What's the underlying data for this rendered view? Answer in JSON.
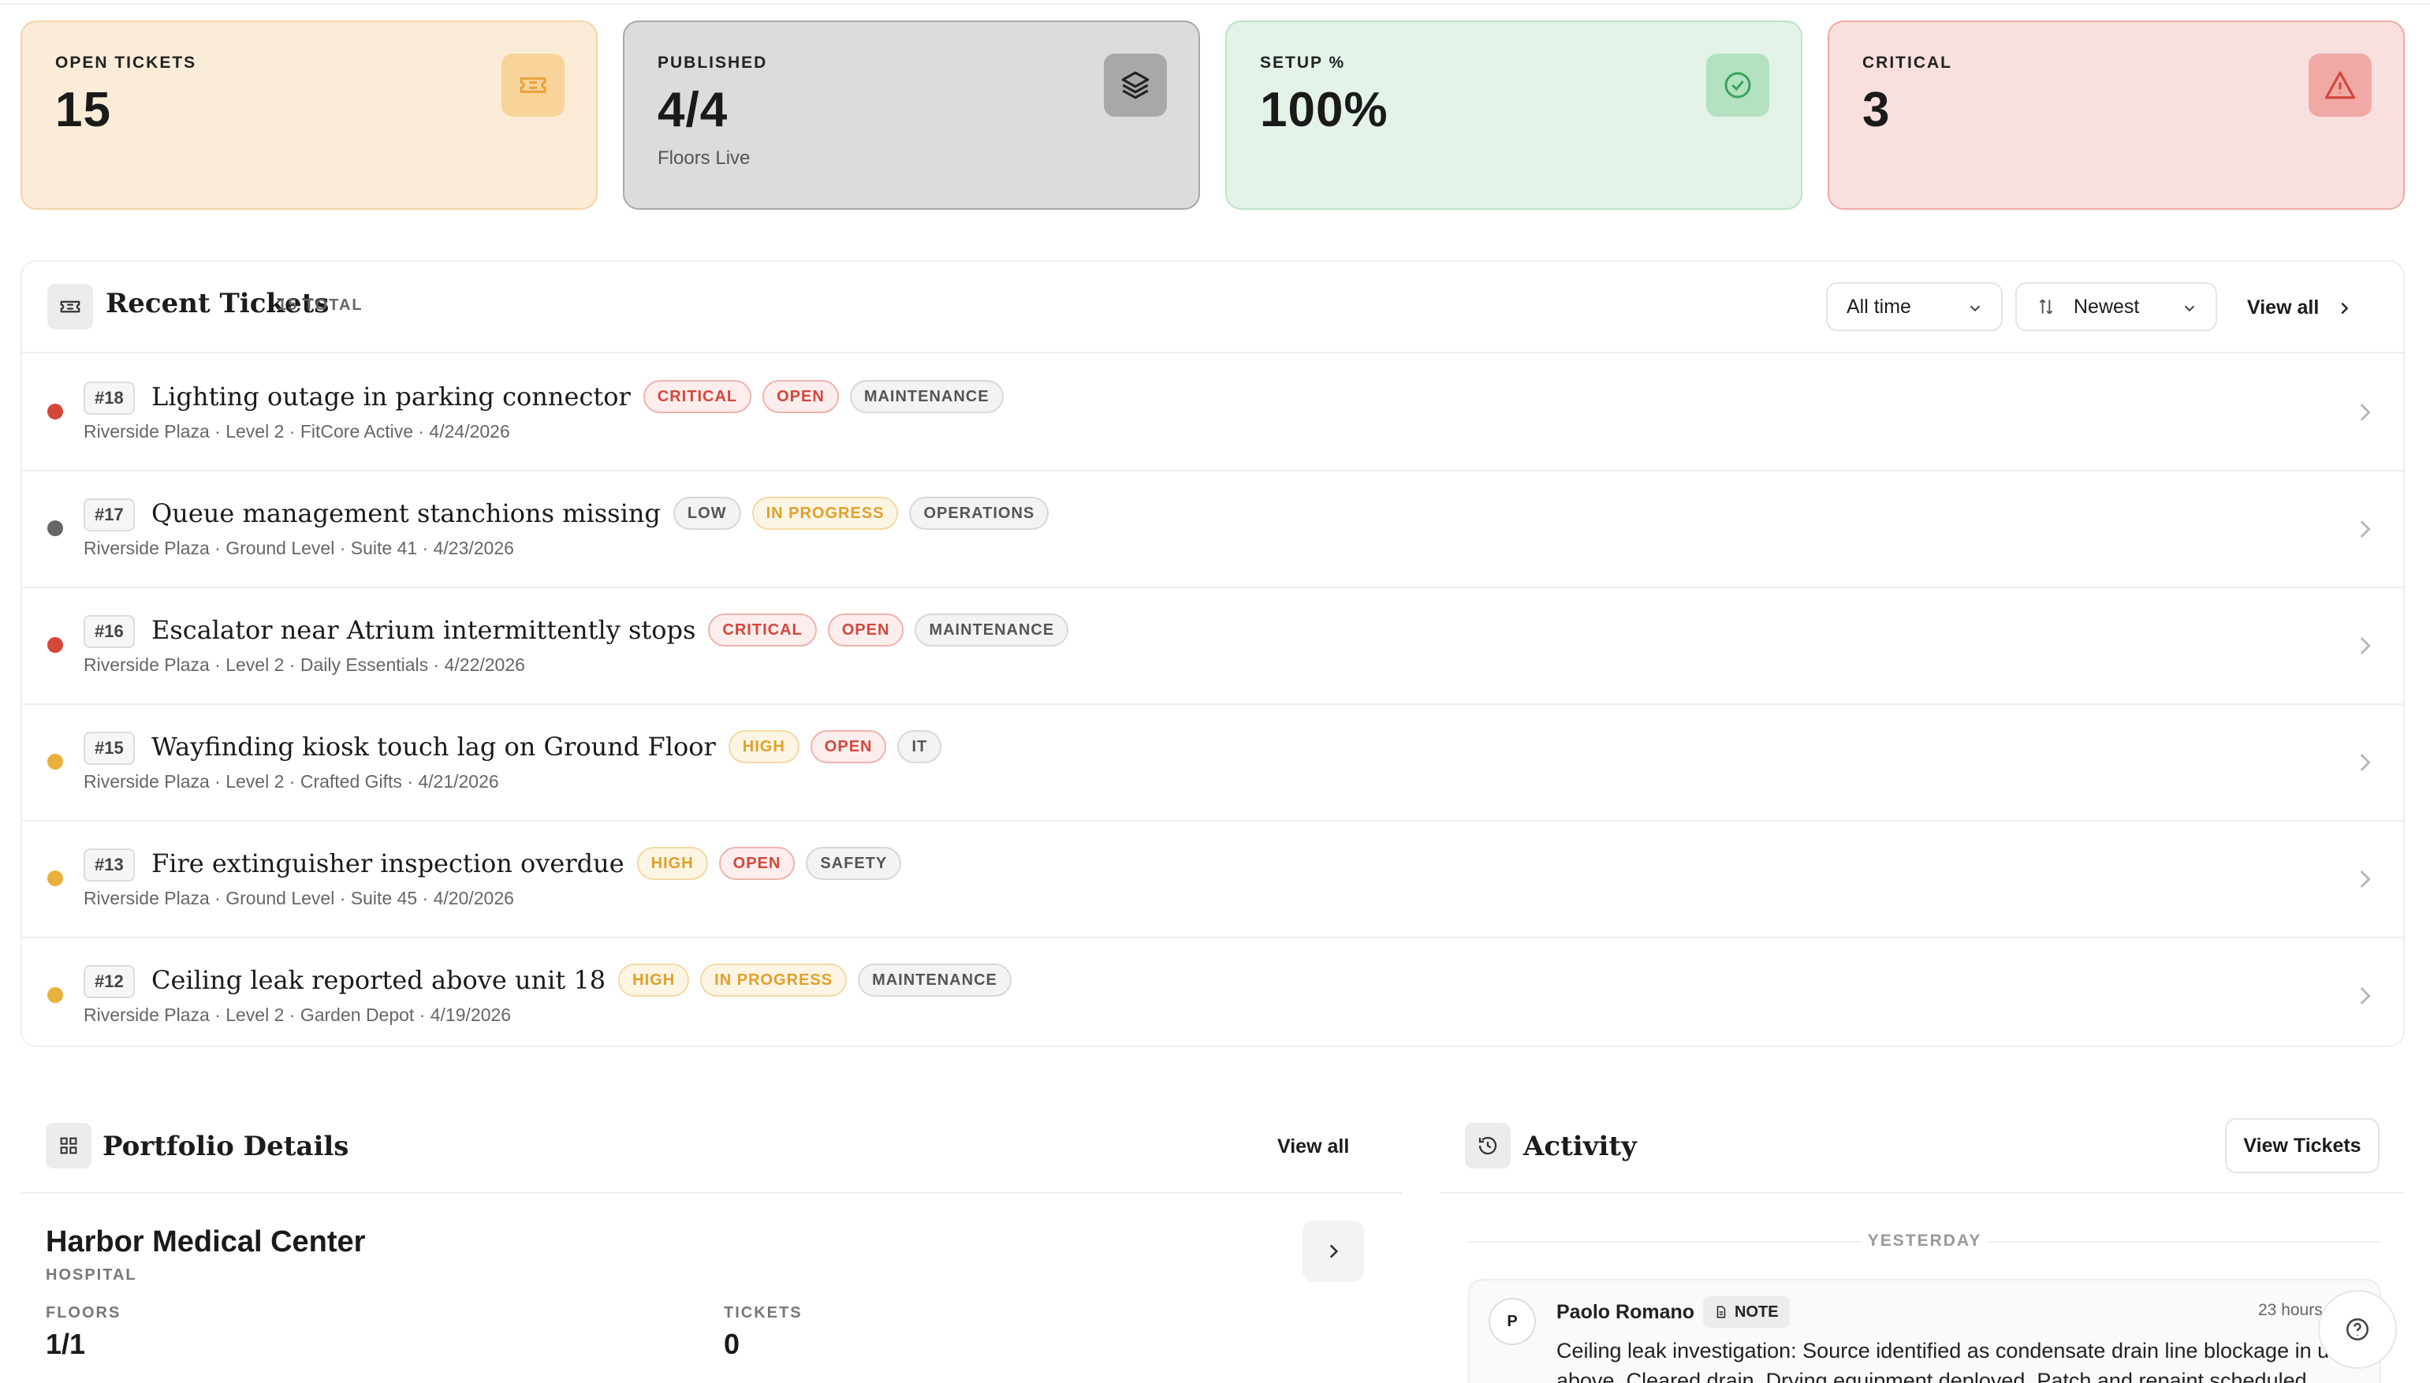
{
  "stats": [
    {
      "label": "OPEN TICKETS",
      "value": "15",
      "sub": "",
      "icon": "ticket-icon",
      "color": "#e8a23a"
    },
    {
      "label": "PUBLISHED",
      "value": "4/4",
      "sub": "Floors Live",
      "icon": "layers-icon",
      "color": "#333333"
    },
    {
      "label": "SETUP %",
      "value": "100%",
      "sub": "",
      "icon": "check-circle-icon",
      "color": "#3aa35c"
    },
    {
      "label": "CRITICAL",
      "value": "3",
      "sub": "",
      "icon": "warning-icon",
      "color": "#d5463b"
    }
  ],
  "recent": {
    "title": "Recent Tickets",
    "count": "15 TOTAL",
    "filter": "All time",
    "sort": "Newest",
    "view_all": "View all"
  },
  "tickets": [
    {
      "id": "#18",
      "title": "Lighting outage in parking connector",
      "badges": [
        "CRITICAL",
        "OPEN",
        "MAINTENANCE"
      ],
      "meta": "Riverside Plaza · Level 2 · FitCore Active · 4/24/2026",
      "dot": "#d5463b"
    },
    {
      "id": "#17",
      "title": "Queue management stanchions missing",
      "badges": [
        "LOW",
        "IN PROGRESS",
        "OPERATIONS"
      ],
      "meta": "Riverside Plaza · Ground Level · Suite 41 · 4/23/2026",
      "dot": "#666666"
    },
    {
      "id": "#16",
      "title": "Escalator near Atrium intermittently stops",
      "badges": [
        "CRITICAL",
        "OPEN",
        "MAINTENANCE"
      ],
      "meta": "Riverside Plaza · Level 2 · Daily Essentials · 4/22/2026",
      "dot": "#d5463b"
    },
    {
      "id": "#15",
      "title": "Wayfinding kiosk touch lag on Ground Floor",
      "badges": [
        "HIGH",
        "OPEN",
        "IT"
      ],
      "meta": "Riverside Plaza · Level 2 · Crafted Gifts · 4/21/2026",
      "dot": "#e8b13e"
    },
    {
      "id": "#13",
      "title": "Fire extinguisher inspection overdue",
      "badges": [
        "HIGH",
        "OPEN",
        "SAFETY"
      ],
      "meta": "Riverside Plaza · Ground Level · Suite 45 · 4/20/2026",
      "dot": "#e8b13e"
    },
    {
      "id": "#12",
      "title": "Ceiling leak reported above unit 18",
      "badges": [
        "HIGH",
        "IN PROGRESS",
        "MAINTENANCE"
      ],
      "meta": "Riverside Plaza · Level 2 · Garden Depot · 4/19/2026",
      "dot": "#e8b13e"
    }
  ],
  "portfolio": {
    "title": "Portfolio Details",
    "view_all": "View all",
    "property": {
      "name": "Harbor Medical Center",
      "type": "HOSPITAL",
      "floors_label": "FLOORS",
      "floors_value": "1/1",
      "tickets_label": "TICKETS",
      "tickets_value": "0"
    }
  },
  "activity": {
    "title": "Activity",
    "view_tickets": "View Tickets",
    "day": "YESTERDAY",
    "entry": {
      "avatar": "P",
      "user": "Paolo Romano",
      "tag": "NOTE",
      "time": "23 hours",
      "text": "Ceiling leak investigation: Source identified as condensate drain line blockage in unit above. Cleared drain. Drying equipment deployed. Patch and repaint scheduled"
    }
  }
}
